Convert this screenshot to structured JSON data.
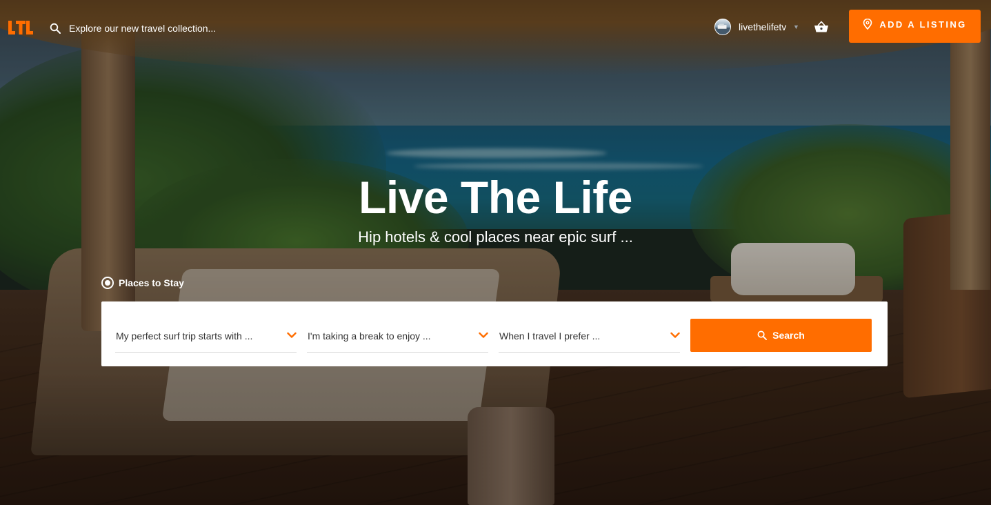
{
  "header": {
    "search_placeholder": "Explore our new travel collection...",
    "username": "livethelifetv",
    "add_listing_label": "ADD A LISTING"
  },
  "hero": {
    "title": "Live The Life",
    "subtitle": "Hip hotels & cool places near epic surf ..."
  },
  "category": {
    "label": "Places to Stay",
    "selected": true
  },
  "filters": [
    {
      "label": "My perfect surf trip starts with ..."
    },
    {
      "label": "I'm taking a break to enjoy ..."
    },
    {
      "label": "When I travel I prefer ..."
    }
  ],
  "search_button_label": "Search",
  "colors": {
    "accent": "#ff6d00",
    "panel": "#ffffff",
    "text_on_dark": "#ffffff"
  },
  "icons": {
    "logo": "ltl-logo",
    "search": "search-icon",
    "cart": "basket-icon",
    "pin": "map-pin-icon",
    "chevron": "chevron-down-icon"
  }
}
